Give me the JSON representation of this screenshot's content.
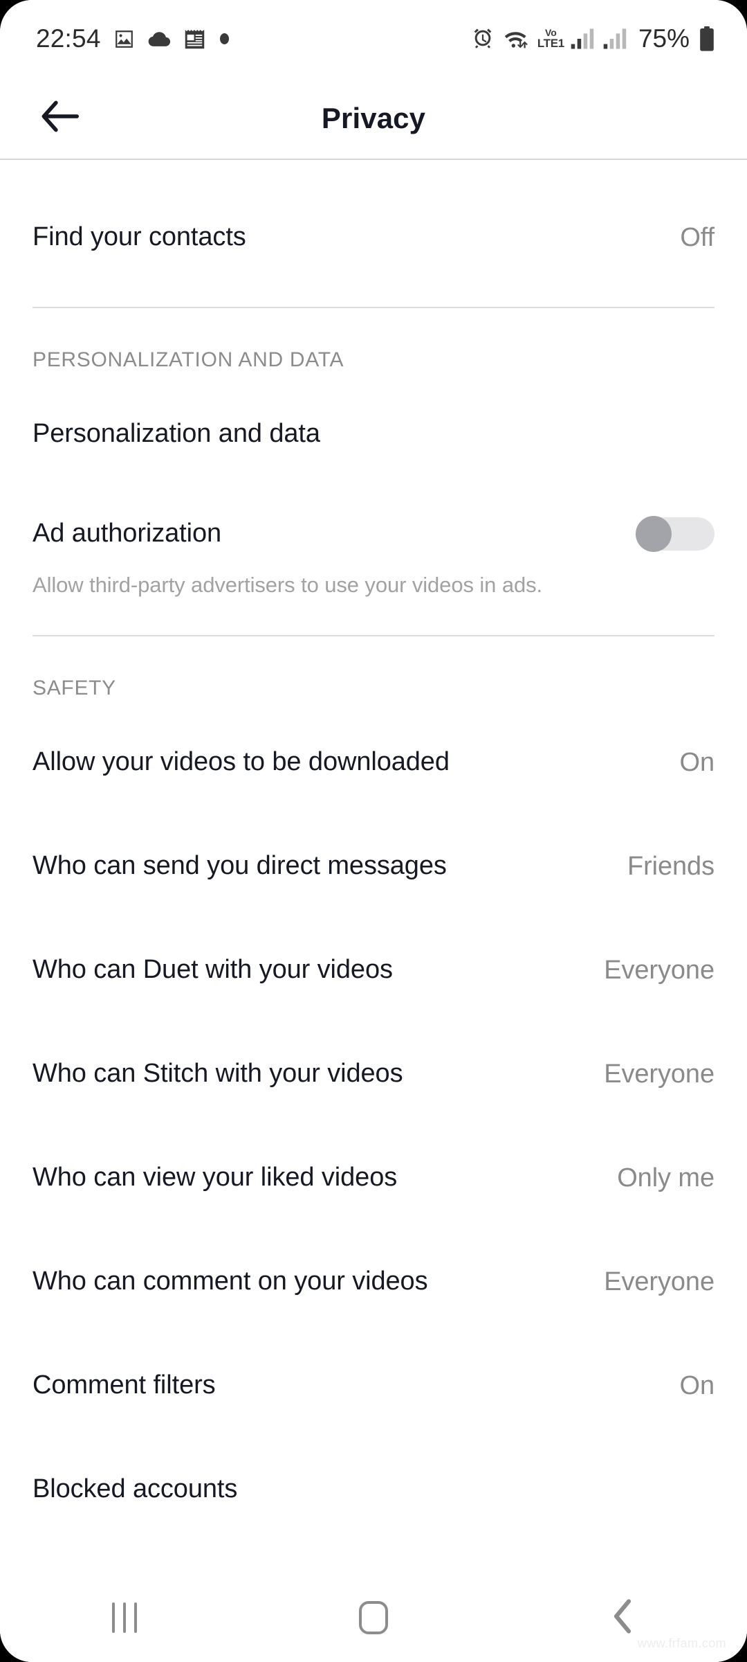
{
  "status_bar": {
    "time": "22:54",
    "battery_percent": "75%",
    "volte_top": "Vo",
    "volte_bottom": "LTE1",
    "left_icons": [
      "photo-icon",
      "cloud-icon",
      "notepad-icon",
      "dot-icon"
    ],
    "right_icons": [
      "alarm-icon",
      "wifi-icon",
      "volte-icon",
      "signal-bars-icon",
      "signal-bars-2-icon",
      "battery-icon"
    ]
  },
  "header": {
    "title": "Privacy",
    "back_icon": "back-arrow-icon"
  },
  "sections": [
    {
      "id": "top",
      "header": null,
      "rows": [
        {
          "label": "Find your contacts",
          "value": "Off",
          "type": "value"
        }
      ]
    },
    {
      "id": "personalization",
      "header": "PERSONALIZATION AND DATA",
      "rows": [
        {
          "label": "Personalization and data",
          "value": "",
          "type": "link"
        },
        {
          "label": "Ad authorization",
          "subtitle": "Allow third-party advertisers to use your videos in ads.",
          "type": "toggle",
          "toggle_state": "off"
        }
      ]
    },
    {
      "id": "safety",
      "header": "SAFETY",
      "rows": [
        {
          "label": "Allow your videos to be downloaded",
          "value": "On",
          "type": "value"
        },
        {
          "label": "Who can send you direct messages",
          "value": "Friends",
          "type": "value"
        },
        {
          "label": "Who can Duet with your videos",
          "value": "Everyone",
          "type": "value"
        },
        {
          "label": "Who can Stitch with your videos",
          "value": "Everyone",
          "type": "value"
        },
        {
          "label": "Who can view your liked videos",
          "value": "Only me",
          "type": "value"
        },
        {
          "label": "Who can comment on your videos",
          "value": "Everyone",
          "type": "value"
        },
        {
          "label": "Comment filters",
          "value": "On",
          "type": "value"
        },
        {
          "label": "Blocked accounts",
          "value": "",
          "type": "link"
        }
      ]
    }
  ],
  "nav_bar": {
    "recents_icon": "recents-icon",
    "home_icon": "home-icon",
    "back_icon": "nav-back-icon"
  },
  "watermark": "www.frfam.com",
  "colors": {
    "text_primary": "#161823",
    "text_secondary": "#8a8a8a",
    "divider": "#dcdcdc",
    "background": "#ffffff",
    "toggle_thumb": "#a3a3aa",
    "toggle_track": "#e6e6e8"
  }
}
